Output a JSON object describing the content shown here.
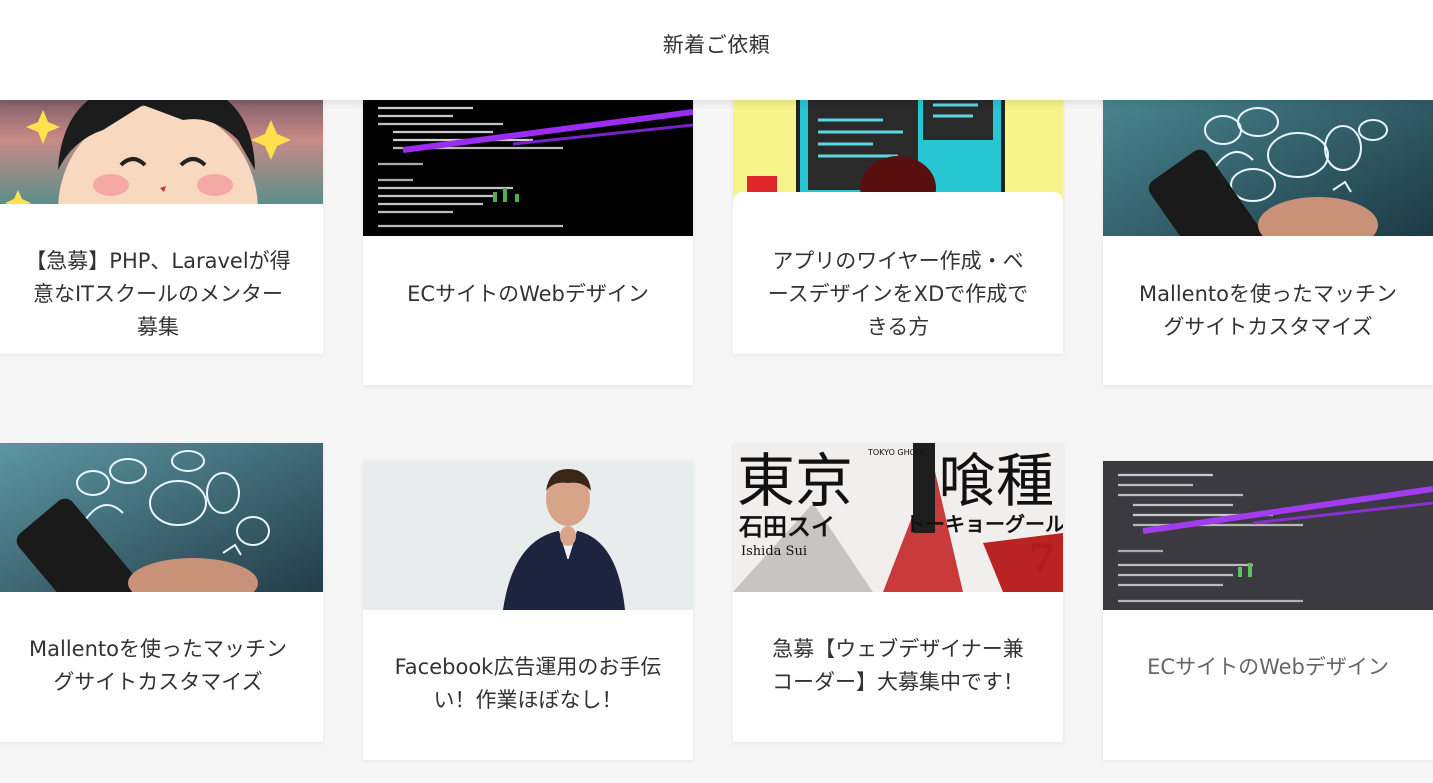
{
  "header": {
    "title": "新着ご依頼"
  },
  "cards": [
    {
      "title": "【急募】PHP、Laravelが得意なITスクールのメンター募集",
      "image": "cartoon-boy-image"
    },
    {
      "title": "ECサイトのWebデザイン",
      "image": "code-screen-image"
    },
    {
      "title": "アプリのワイヤー作成・ベースデザインをXDで作成できる方",
      "image": "monitor-illustration-image"
    },
    {
      "title": "Mallentoを使ったマッチングサイトカスタマイズ",
      "image": "phone-doodles-image"
    },
    {
      "title": "Mallentoを使ったマッチングサイトカスタマイズ",
      "image": "phone-doodles-image"
    },
    {
      "title": "Facebook広告運用のお手伝い！作業ほぼなし！",
      "image": "businessman-image"
    },
    {
      "title": "急募【ウェブデザイナー兼コーダー】大募集中です！",
      "image": "manga-cover-image",
      "image_text": {
        "title_left": "東京",
        "title_right": "喰種",
        "author": "石田スイ",
        "author_romaji": "Ishida Sui",
        "katakana": "トーキョーグール",
        "volume": "7",
        "roman": "TOKYO GHOUL"
      }
    },
    {
      "title": "ECサイトのWebデザイン",
      "image": "code-screen-image"
    }
  ],
  "colors": {
    "background": "#f6f6f6",
    "card": "#ffffff",
    "text": "#333333"
  }
}
